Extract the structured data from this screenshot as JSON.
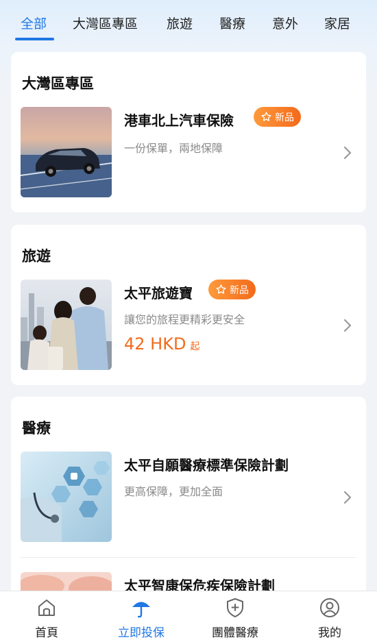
{
  "tabs": [
    {
      "label": "全部",
      "active": true
    },
    {
      "label": "大灣區專區",
      "active": false
    },
    {
      "label": "旅遊",
      "active": false
    },
    {
      "label": "醫療",
      "active": false
    },
    {
      "label": "意外",
      "active": false
    },
    {
      "label": "家居",
      "active": false
    }
  ],
  "sections": [
    {
      "title": "大灣區專區",
      "products": [
        {
          "name": "港車北上汽車保險",
          "badge": "新品",
          "desc": "一份保單，兩地保障",
          "image": "car-photo"
        }
      ]
    },
    {
      "title": "旅遊",
      "products": [
        {
          "name": "太平旅遊寶",
          "badge": "新品",
          "desc": "讓您的旅程更精彩更安全",
          "price": "42 HKD",
          "price_suffix": "起",
          "image": "family-travel-photo"
        }
      ]
    },
    {
      "title": "醫療",
      "products": [
        {
          "name": "太平自願醫療標準保險計劃",
          "desc": "更高保障，更加全面",
          "image": "medical-icons-photo"
        },
        {
          "name": "太平智康保危疾保險計劃",
          "image": "hands-photo"
        }
      ]
    }
  ],
  "bottom_nav": [
    {
      "label": "首頁",
      "icon": "home-icon",
      "active": false
    },
    {
      "label": "立即投保",
      "icon": "umbrella-icon",
      "active": true
    },
    {
      "label": "團體醫療",
      "icon": "shield-plus-icon",
      "active": false
    },
    {
      "label": "我的",
      "icon": "user-icon",
      "active": false
    }
  ],
  "colors": {
    "accent": "#1f78e4",
    "price": "#f26a1b",
    "badge": "#f26a1b"
  }
}
